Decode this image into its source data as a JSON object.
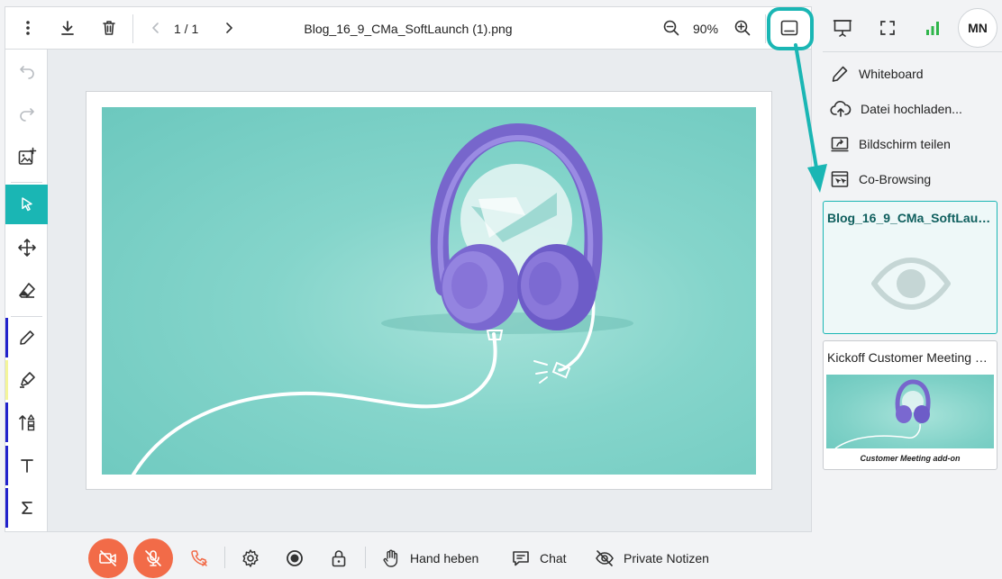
{
  "viewer": {
    "page_indicator": "1 / 1",
    "file_name": "Blog_16_9_CMa_SoftLaunch (1).png",
    "zoom": "90%"
  },
  "image": {
    "caption": "Customer Meeting add-on"
  },
  "avatar": {
    "initials": "MN"
  },
  "menu": {
    "items": [
      {
        "label": "Whiteboard",
        "icon": "pencil-icon"
      },
      {
        "label": "Datei hochladen...",
        "icon": "cloud-upload-icon"
      },
      {
        "label": "Bildschirm teilen",
        "icon": "screen-share-icon"
      },
      {
        "label": "Co-Browsing",
        "icon": "co-browsing-icon"
      }
    ]
  },
  "documents": [
    {
      "title": "Blog_16_9_CMa_SoftLaunch (1).png",
      "selected": true
    },
    {
      "title": "Kickoff Customer Meeting add-on",
      "selected": false
    }
  ],
  "bottom": {
    "hand": "Hand heben",
    "chat": "Chat",
    "notes": "Private Notizen"
  },
  "colors": {
    "accent": "#1ab6b4",
    "danger": "#f26b48",
    "signal": "#2fb54a"
  }
}
